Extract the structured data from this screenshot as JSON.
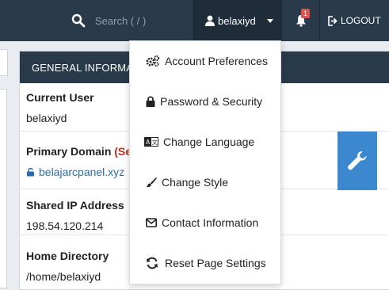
{
  "topbar": {
    "search_placeholder": "Search ( / )",
    "username": "belaxiyd",
    "notification_count": "1",
    "logout_label": "LOGOUT"
  },
  "panel": {
    "title": "GENERAL INFORMA",
    "current_user_label": "Current User",
    "current_user_value": "belaxiyd",
    "primary_domain_label": "Primary Domain",
    "primary_domain_tag": "(Se",
    "primary_domain_value": "belajarcpanel.xyz",
    "shared_ip_label": "Shared IP Address",
    "shared_ip_value": "198.54.120.214",
    "home_dir_label": "Home Directory",
    "home_dir_value": "/home/belaxiyd"
  },
  "dropdown": {
    "items": [
      {
        "label": "Account Preferences",
        "icon": "gears-icon"
      },
      {
        "label": "Password & Security",
        "icon": "lock-icon"
      },
      {
        "label": "Change Language",
        "icon": "language-icon"
      },
      {
        "label": "Change Style",
        "icon": "brush-icon"
      },
      {
        "label": "Contact Information",
        "icon": "envelope-icon"
      },
      {
        "label": "Reset Page Settings",
        "icon": "refresh-icon"
      }
    ]
  },
  "colors": {
    "topbar": "#293a4a",
    "accent_blue": "#3b88cf",
    "link": "#2d6ca8",
    "badge": "#d9534f"
  }
}
